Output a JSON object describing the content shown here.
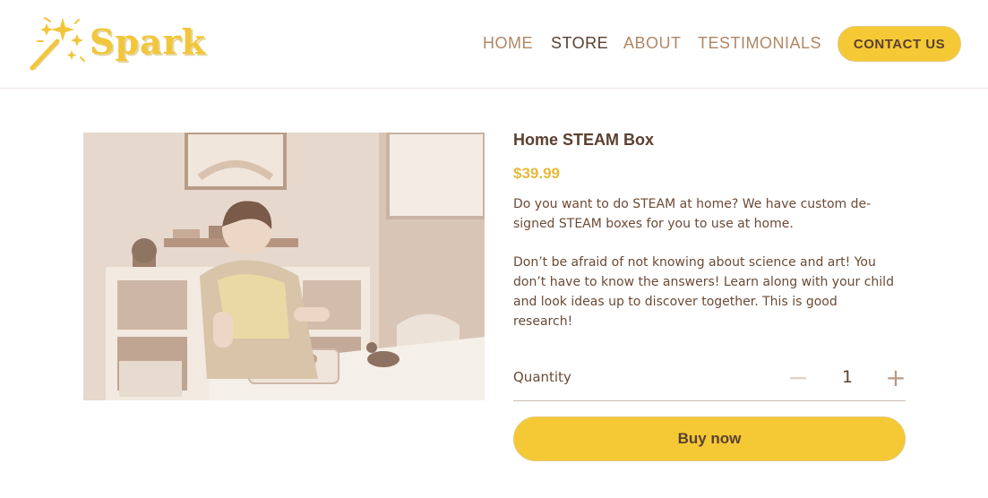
{
  "brand": {
    "name": "Spark",
    "icon": "magic-wand-icon"
  },
  "nav": {
    "items": [
      {
        "label": "HOME"
      },
      {
        "label": "STORE"
      },
      {
        "label": "ABOUT"
      },
      {
        "label": "TESTIMONIALS"
      }
    ],
    "active": "STORE",
    "contact_label": "CONTACT US"
  },
  "product": {
    "title": "Home STEAM Box",
    "price": "$39.99",
    "description_1": "Do you want to do STEAM at home? We have custom de-signed STEAM boxes for you to use at home.",
    "description_2": "Don’t be afraid of not knowing about science and art! You don’t have to know the answers! Learn along with your child and look ideas up to discover together. This is good research!",
    "quantity_label": "Quantity",
    "quantity": "1",
    "minus_symbol": "−",
    "plus_symbol": "+",
    "buy_label": "Buy now",
    "image_subject": "child-playing-with-toys-photo"
  },
  "colors": {
    "accent": "#f5c935",
    "brand_text": "#f1c63a",
    "text": "#6b4a35",
    "nav_inactive": "#b08766",
    "nav_active": "#5a4030"
  }
}
